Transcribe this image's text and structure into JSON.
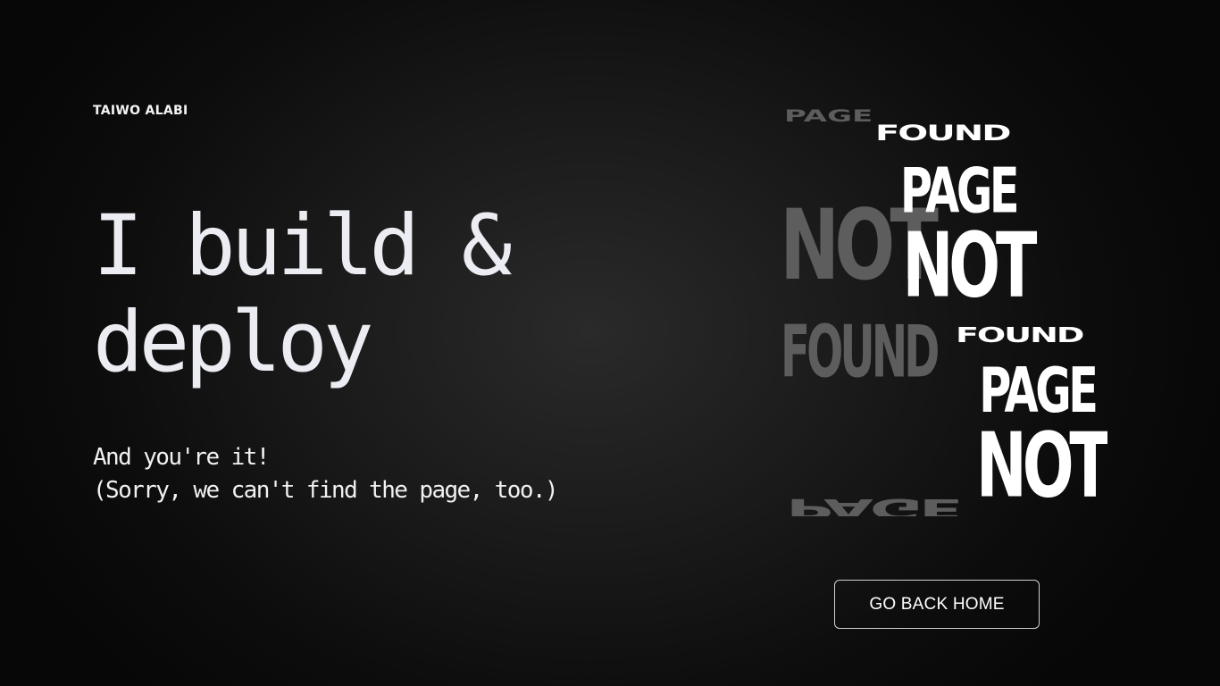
{
  "brand": {
    "name": "TAIWO ALABI"
  },
  "hero": {
    "headline_line1": "I build &",
    "headline_line2": "deploy",
    "sub_line1": "And you're it!",
    "sub_line2": "(Sorry, we can't find the page, too.)"
  },
  "illustration": {
    "words": {
      "page": "PAGE",
      "not": "NOT",
      "found": "FOUND"
    },
    "colors": {
      "front": "#ffffff",
      "back": "#5d5d5d"
    }
  },
  "actions": {
    "home_label": "GO BACK HOME"
  },
  "colors": {
    "background": "#1b1b1b",
    "text": "#f1f1f3",
    "button_border": "#cfcfcf"
  }
}
